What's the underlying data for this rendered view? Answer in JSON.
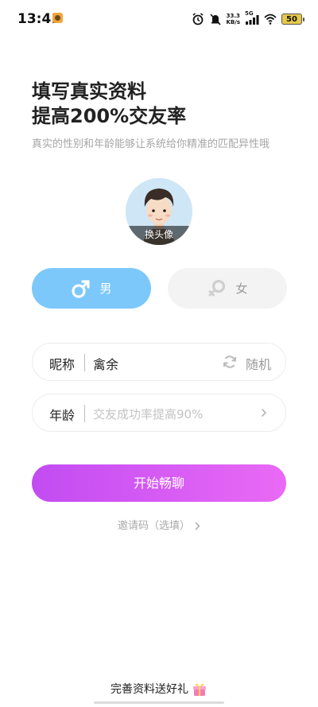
{
  "status_bar": {
    "time": "13:41",
    "net_speed_value": "33.3",
    "net_speed_unit": "KB/s",
    "network_type": "5G",
    "battery": "50"
  },
  "header": {
    "title_line1": "填写真实资料",
    "title_line2": "提高200%交友率",
    "subtitle": "真实的性别和年龄能够让系统给你精准的匹配异性哦"
  },
  "avatar": {
    "caption": "换头像"
  },
  "gender": {
    "male_label": "男",
    "female_label": "女",
    "selected": "male"
  },
  "nickname": {
    "label": "昵称",
    "value": "禽余",
    "random_label": "随机"
  },
  "age": {
    "label": "年龄",
    "placeholder": "交友成功率提高90%"
  },
  "start_button": {
    "label": "开始畅聊"
  },
  "invite": {
    "label": "邀请码（选填）"
  },
  "promo": {
    "label": "完善资料送好礼"
  },
  "colors": {
    "male_accent": "#7cc8fb",
    "start_gradient_from": "#c24cf2",
    "start_gradient_to": "#e96af5"
  }
}
